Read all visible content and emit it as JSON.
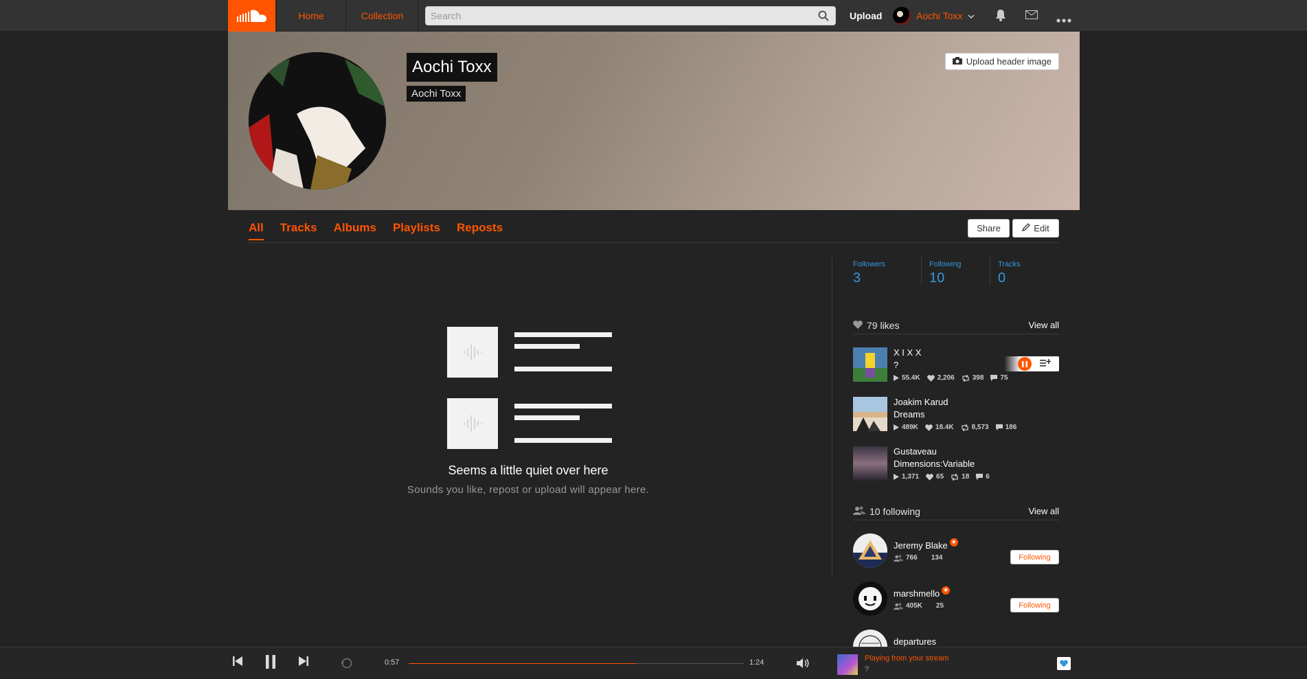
{
  "topbar": {
    "home": "Home",
    "collection": "Collection",
    "search_placeholder": "Search",
    "upload": "Upload",
    "user_name": "Aochi Toxx"
  },
  "hero": {
    "name": "Aochi Toxx",
    "subtitle": "Aochi Toxx",
    "upload_header": "Upload header image"
  },
  "tabs": [
    "All",
    "Tracks",
    "Albums",
    "Playlists",
    "Reposts"
  ],
  "actions": {
    "share": "Share",
    "edit": "Edit"
  },
  "empty": {
    "title": "Seems a little quiet over here",
    "subtitle": "Sounds you like, repost or upload will appear here."
  },
  "stats": [
    {
      "label": "Followers",
      "value": "3"
    },
    {
      "label": "Following",
      "value": "10"
    },
    {
      "label": "Tracks",
      "value": "0"
    }
  ],
  "likes": {
    "count": "79 likes",
    "view_all": "View all",
    "items": [
      {
        "user": "X I X X",
        "title": "?",
        "plays": "55.4K",
        "likes": "2,206",
        "reposts": "398",
        "comments": "75"
      },
      {
        "user": "Joakim Karud",
        "title": "Dreams",
        "plays": "489K",
        "likes": "18.4K",
        "reposts": "8,573",
        "comments": "186"
      },
      {
        "user": "Gustaveau",
        "title": "Dimensions:Variable",
        "plays": "1,371",
        "likes": "65",
        "reposts": "18",
        "comments": "6"
      }
    ]
  },
  "following": {
    "count": "10 following",
    "view_all": "View all",
    "button": "Following",
    "items": [
      {
        "name": "Jeremy Blake",
        "followers": "766",
        "tracks": "134"
      },
      {
        "name": "marshmello",
        "followers": "405K",
        "tracks": "25"
      },
      {
        "name": "departures"
      }
    ]
  },
  "player": {
    "elapsed": "0:57",
    "duration": "1:24",
    "progress": 0.68,
    "context": "Playing from your stream",
    "track": "?"
  },
  "colors": {
    "accent": "#ff5500",
    "stat_blue": "#3498db",
    "background": "#232323"
  }
}
